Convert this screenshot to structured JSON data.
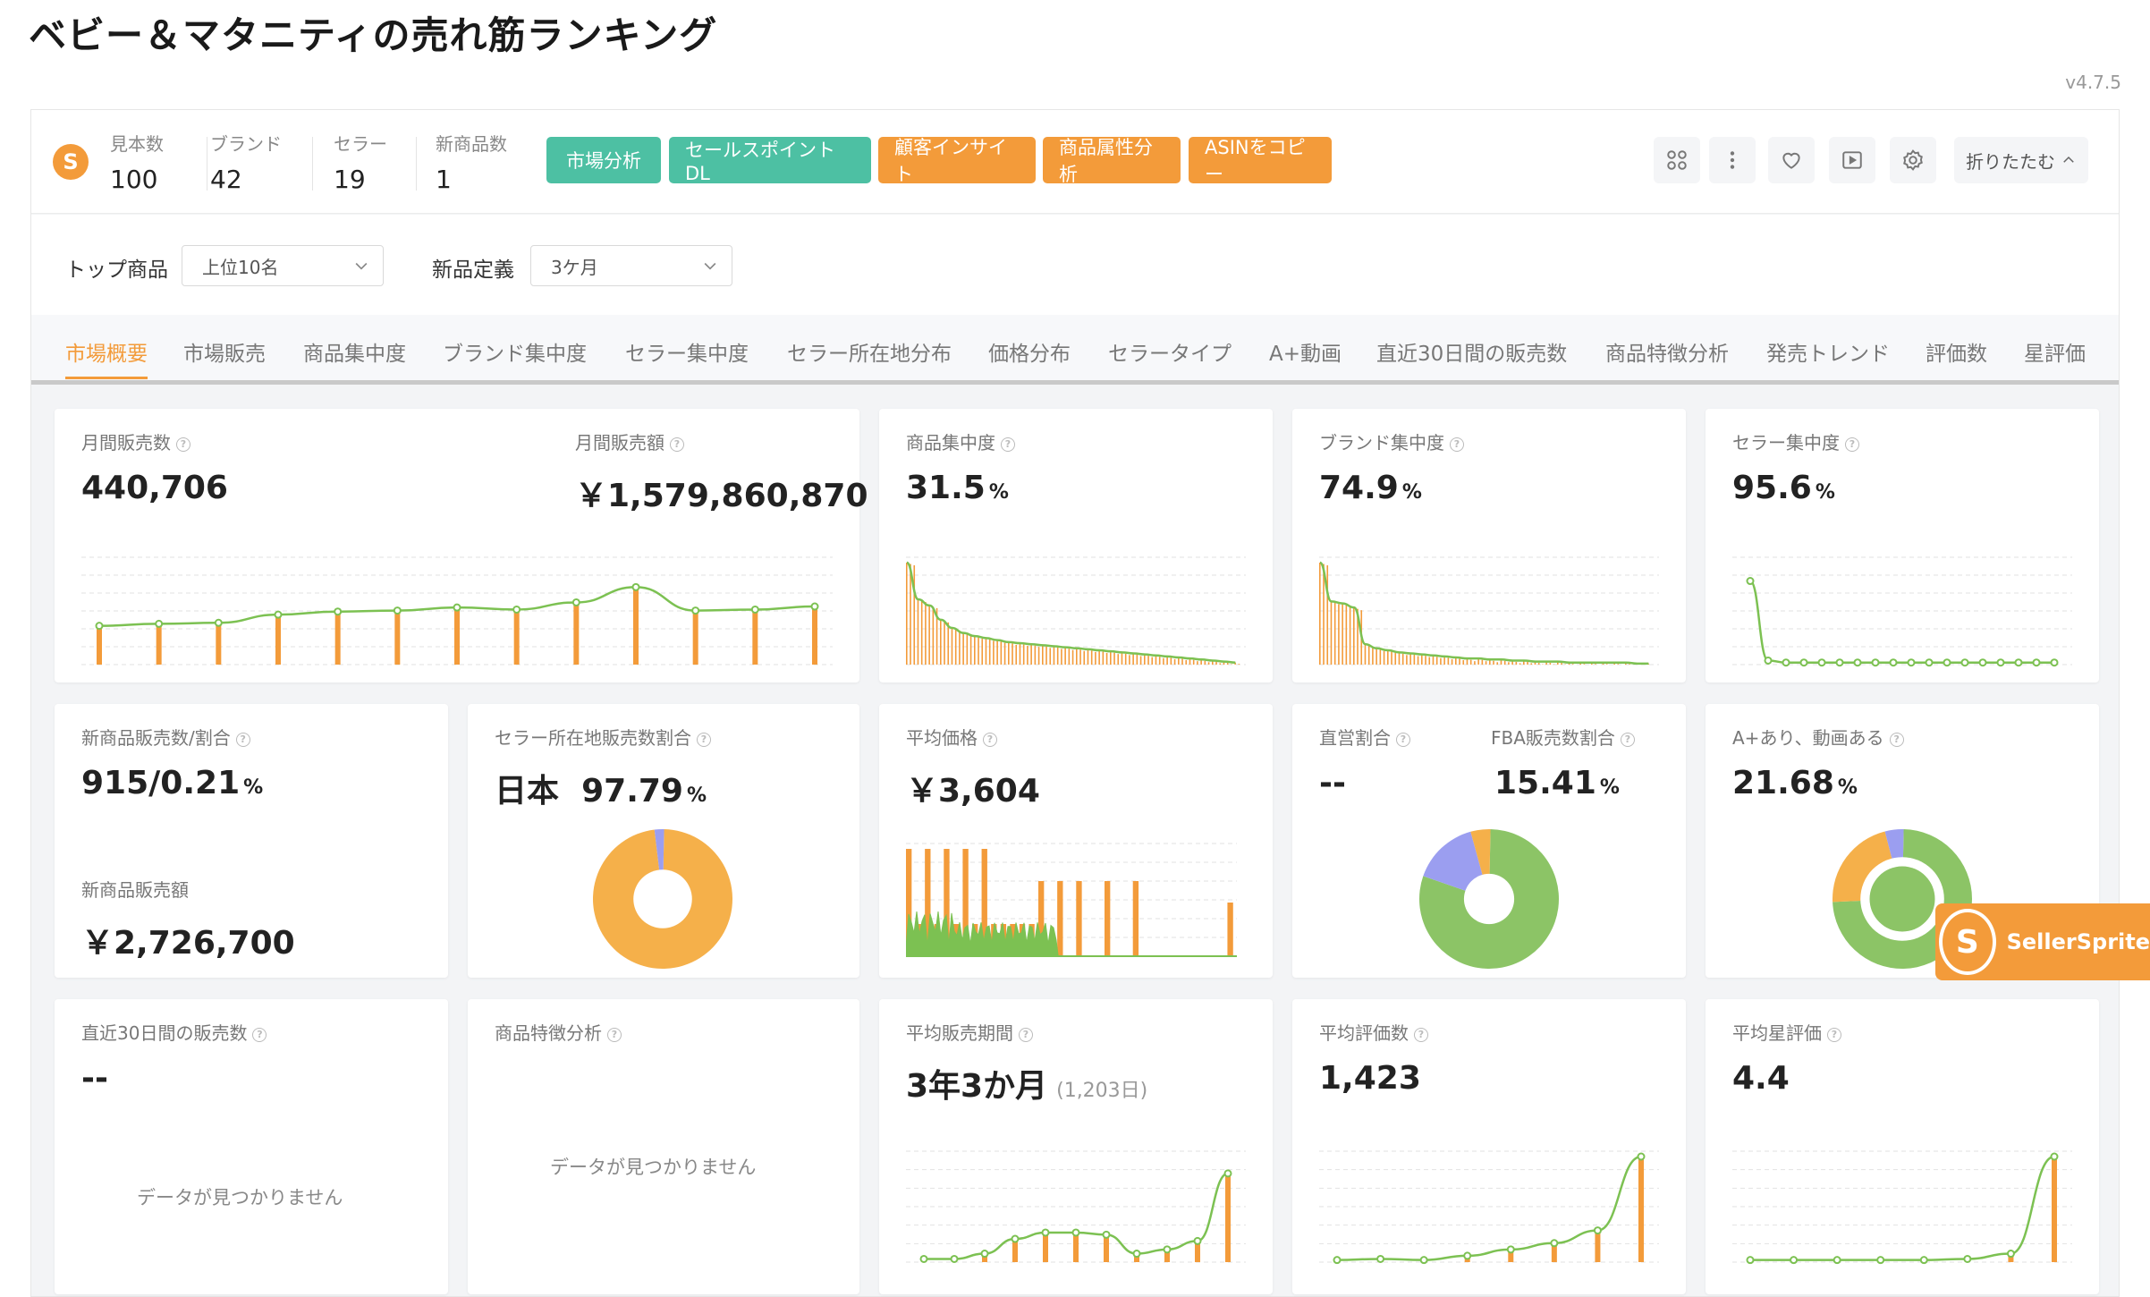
{
  "page": {
    "title": "ベビー＆マタニティの売れ筋ランキング",
    "version": "v4.7.5"
  },
  "header": {
    "stats": [
      {
        "label": "見本数",
        "value": "100"
      },
      {
        "label": "ブランド",
        "value": "42"
      },
      {
        "label": "セラー",
        "value": "19"
      },
      {
        "label": "新商品数",
        "value": "1"
      }
    ],
    "buttons": [
      "市場分析",
      "セールスポイントDL",
      "顧客インサイト",
      "商品属性分析",
      "ASINをコピー"
    ],
    "collapse_label": "折りたたむ",
    "icons": [
      "command-icon",
      "more-vertical-icon",
      "heart-icon",
      "play-icon",
      "settings-icon"
    ]
  },
  "filters": {
    "top_label": "トップ商品",
    "top_value": "上位10名",
    "new_label": "新品定義",
    "new_value": "3ケ月"
  },
  "tabs": [
    "市場概要",
    "市場販売",
    "商品集中度",
    "ブランド集中度",
    "セラー集中度",
    "セラー所在地分布",
    "価格分布",
    "セラータイプ",
    "A+動画",
    "直近30日間の販売数",
    "商品特徴分析",
    "発売トレンド",
    "評価数",
    "星評価"
  ],
  "cards": {
    "monthly_sales_label": "月間販売数",
    "monthly_sales_value": "440,706",
    "monthly_revenue_label": "月間販売額",
    "monthly_revenue_value": "￥1,579,860,870",
    "product_conc_label": "商品集中度",
    "product_conc_value": "31.5",
    "brand_conc_label": "ブランド集中度",
    "brand_conc_value": "74.9",
    "seller_conc_label": "セラー集中度",
    "seller_conc_value": "95.6",
    "new_sales_label": "新商品販売数/割合",
    "new_sales_value": "915/0.21",
    "new_revenue_label": "新商品販売額",
    "new_revenue_value": "￥2,726,700",
    "seller_loc_label": "セラー所在地販売数割合",
    "seller_loc_country": "日本",
    "seller_loc_value": "97.79",
    "avg_price_label": "平均価格",
    "avg_price_value": "￥3,604",
    "direct_label": "直営割合",
    "direct_value": "--",
    "fba_label": "FBA販売数割合",
    "fba_value": "15.41",
    "aplus_label": "A+あり、動画ある",
    "aplus_value": "21.68",
    "recent30_label": "直近30日間の販売数",
    "recent30_value": "--",
    "recent30_empty": "データが見つかりません",
    "feature_label": "商品特徴分析",
    "feature_empty": "データが見つかりません",
    "avg_period_label": "平均販売期間",
    "avg_period_value": "3年3か月",
    "avg_period_days": "(1,203日)",
    "avg_reviews_label": "平均評価数",
    "avg_reviews_value": "1,423",
    "avg_rating_label": "平均星評価",
    "avg_rating_value": "4.4",
    "percent_unit": "%"
  },
  "badge": {
    "text": "SellerSprite"
  },
  "colors": {
    "accent_orange": "#f39b3a",
    "teal": "#4dc0a3",
    "line_green": "#7cc152",
    "purple": "#9b9ef0"
  },
  "chart_data": [
    {
      "type": "line",
      "name": "月間販売数トレンド",
      "values": [
        38,
        40,
        41,
        49,
        52,
        53,
        56,
        54,
        61,
        76,
        53,
        54,
        57
      ],
      "ylim": [
        0,
        100
      ]
    },
    {
      "type": "bar",
      "name": "商品集中度",
      "values": [
        100,
        64,
        58,
        44,
        36,
        31,
        28,
        26,
        24,
        22,
        21,
        20,
        19,
        18,
        17,
        16,
        15,
        14,
        13,
        12,
        11,
        10,
        9,
        8,
        7,
        6,
        5,
        4,
        3,
        2
      ],
      "ylim": [
        0,
        100
      ]
    },
    {
      "type": "bar",
      "name": "ブランド集中度",
      "values": [
        100,
        62,
        60,
        56,
        20,
        16,
        14,
        12,
        11,
        10,
        9,
        8,
        7,
        6,
        6,
        5,
        5,
        4,
        4,
        3,
        3,
        3,
        2,
        2,
        2,
        2,
        2,
        2,
        1,
        1
      ],
      "ylim": [
        0,
        100
      ]
    },
    {
      "type": "line",
      "name": "セラー集中度",
      "values": [
        82,
        4,
        2,
        2,
        2,
        2,
        2,
        2,
        2,
        2,
        2,
        2,
        2,
        2,
        2,
        2,
        2,
        2
      ],
      "ylim": [
        0,
        100
      ]
    },
    {
      "type": "pie",
      "name": "セラー所在地",
      "slices": [
        97.79,
        2.21
      ]
    },
    {
      "type": "bar",
      "name": "価格分布",
      "values": [
        100,
        30,
        100,
        30,
        100,
        30,
        100,
        30,
        100,
        30,
        30,
        30,
        30,
        30,
        70,
        0,
        70,
        0,
        70,
        0,
        0,
        70,
        0,
        0,
        70,
        0,
        0,
        0,
        0,
        0,
        0,
        0,
        0,
        0,
        50
      ],
      "ylim": [
        0,
        100
      ]
    },
    {
      "type": "pie",
      "name": "FBA",
      "slices": [
        80,
        15.41,
        4.59
      ]
    },
    {
      "type": "pie",
      "name": "A+動画",
      "slices": [
        74,
        21.68,
        4.32
      ]
    },
    {
      "type": "line",
      "name": "平均販売期間",
      "values": [
        3,
        3,
        8,
        22,
        28,
        28,
        26,
        8,
        12,
        20,
        84
      ],
      "ylim": [
        0,
        100
      ]
    },
    {
      "type": "line",
      "name": "平均評価数",
      "values": [
        2,
        3,
        2,
        6,
        12,
        18,
        30,
        100
      ],
      "ylim": [
        0,
        100
      ]
    },
    {
      "type": "line",
      "name": "平均星評価",
      "values": [
        2,
        2,
        2,
        2,
        2,
        3,
        8,
        100
      ],
      "ylim": [
        0,
        100
      ]
    }
  ]
}
